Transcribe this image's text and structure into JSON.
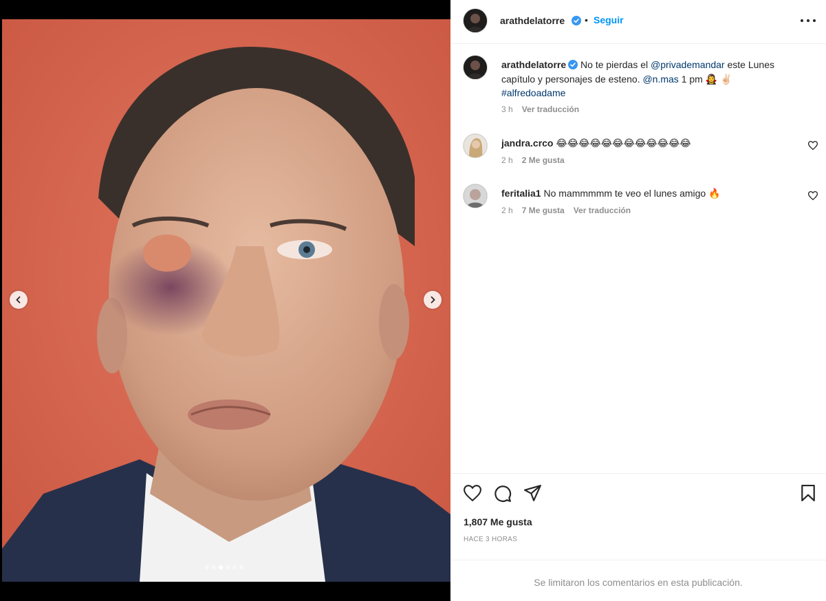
{
  "post": {
    "author": "arathdelatorre",
    "follow_label": "Seguir",
    "separator": "•",
    "caption": {
      "text_1": "No te pierdas el ",
      "mention_1": "@privademandar",
      "text_2": " este Lunes capítulo y personajes de esteno. ",
      "mention_2": "@n.mas",
      "text_3": " 1 pm 🧛‍♀️ ✌🏻",
      "hashtag": "#alfredoadame",
      "time": "3 h",
      "translate": "Ver traducción"
    },
    "likes": "1,807 Me gusta",
    "time_ago": "HACE 3 HORAS",
    "comments_disabled": "Se limitaron los comentarios en esta publicación."
  },
  "comments": [
    {
      "user": "jandra.crco",
      "text": "😂😂😂😂😂😂😂😂😂😂😂😂",
      "time": "2 h",
      "likes": "2 Me gusta",
      "translate": ""
    },
    {
      "user": "feritalia1",
      "text": "No mammmmm te veo el lunes amigo 🔥",
      "time": "2 h",
      "likes": "7 Me gusta",
      "translate": "Ver traducción"
    }
  ],
  "carousel": {
    "count": 6,
    "active": 2
  },
  "icons": {
    "verified": "verified-badge-icon",
    "more": "more-options-icon",
    "like": "heart-icon",
    "comment": "comment-icon",
    "share": "share-icon",
    "save": "bookmark-icon",
    "prev": "chevron-left-icon",
    "next": "chevron-right-icon"
  },
  "colors": {
    "accent": "#0095f6",
    "mention": "#00376b",
    "muted": "#8e8e8e",
    "text": "#262626"
  }
}
